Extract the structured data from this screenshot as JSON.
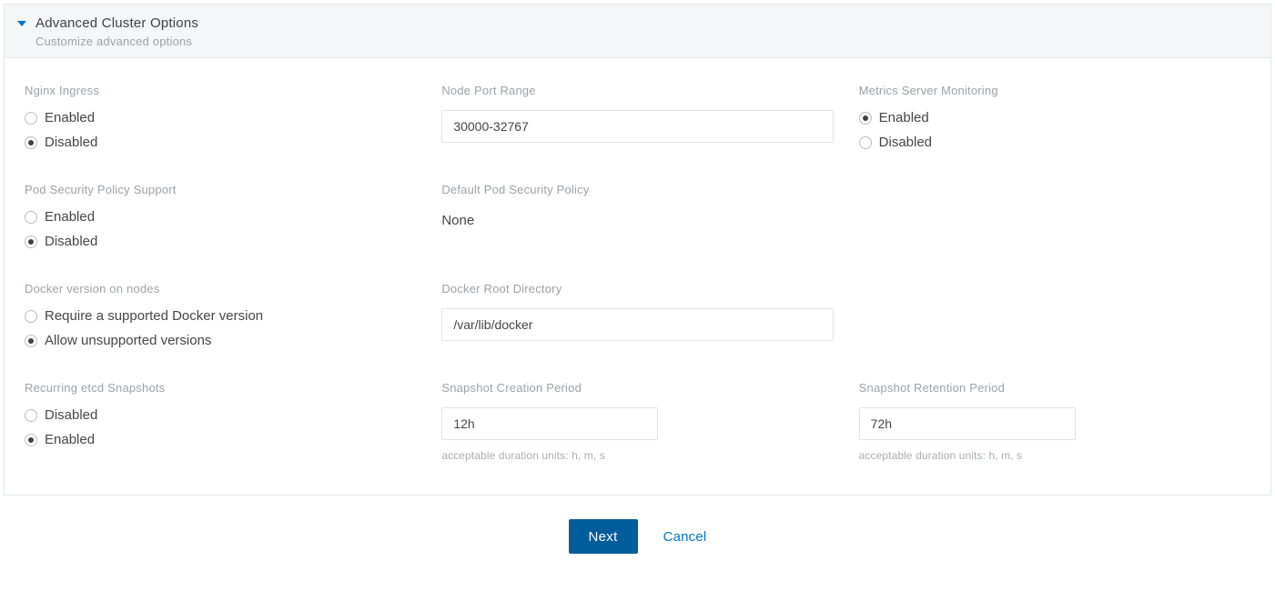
{
  "header": {
    "title": "Advanced Cluster Options",
    "subtitle": "Customize advanced options"
  },
  "fields": {
    "nginx_ingress": {
      "label": "Nginx Ingress",
      "options": {
        "enabled": "Enabled",
        "disabled": "Disabled"
      },
      "selected": "disabled"
    },
    "node_port_range": {
      "label": "Node Port Range",
      "value": "30000-32767"
    },
    "metrics_server": {
      "label": "Metrics Server Monitoring",
      "options": {
        "enabled": "Enabled",
        "disabled": "Disabled"
      },
      "selected": "enabled"
    },
    "pod_security_support": {
      "label": "Pod Security Policy Support",
      "options": {
        "enabled": "Enabled",
        "disabled": "Disabled"
      },
      "selected": "disabled"
    },
    "default_pod_security": {
      "label": "Default Pod Security Policy",
      "value": "None"
    },
    "docker_version": {
      "label": "Docker version on nodes",
      "options": {
        "require": "Require a supported Docker version",
        "allow": "Allow unsupported versions"
      },
      "selected": "allow"
    },
    "docker_root": {
      "label": "Docker Root Directory",
      "value": "/var/lib/docker"
    },
    "etcd_snapshots": {
      "label": "Recurring etcd Snapshots",
      "options": {
        "disabled": "Disabled",
        "enabled": "Enabled"
      },
      "selected": "enabled"
    },
    "snapshot_creation": {
      "label": "Snapshot Creation Period",
      "value": "12h",
      "help": "acceptable duration units: h, m, s"
    },
    "snapshot_retention": {
      "label": "Snapshot Retention Period",
      "value": "72h",
      "help": "acceptable duration units: h, m, s"
    }
  },
  "footer": {
    "next": "Next",
    "cancel": "Cancel"
  }
}
